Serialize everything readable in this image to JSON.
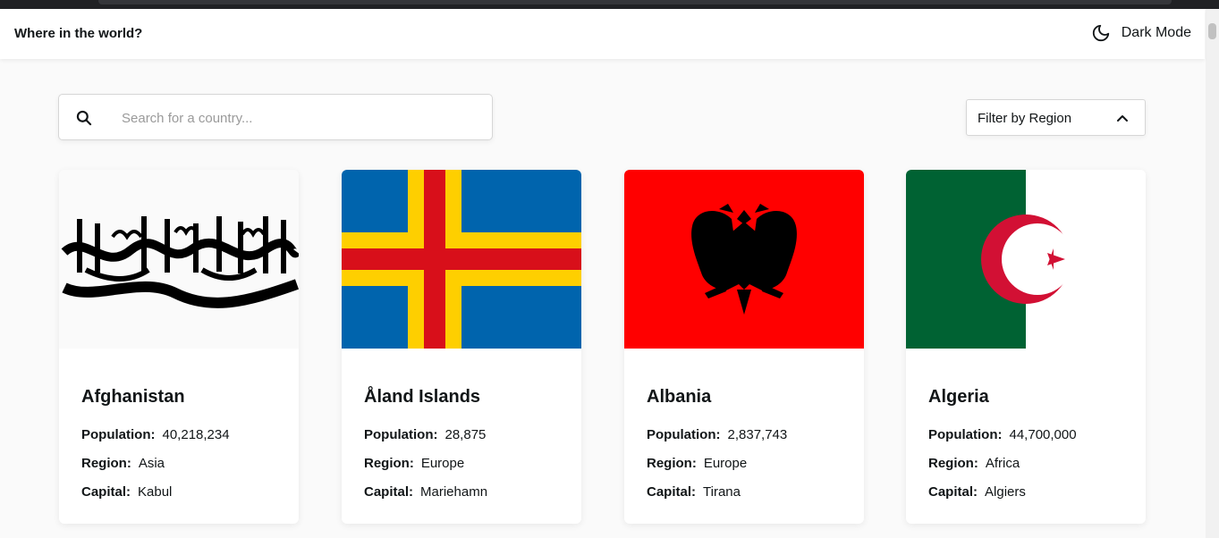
{
  "header": {
    "title": "Where in the world?",
    "mode_label": "Dark Mode",
    "mode_icon": "moon-icon"
  },
  "search": {
    "placeholder": "Search for a country...",
    "value": "",
    "icon": "search-icon"
  },
  "filter": {
    "label": "Filter by Region",
    "icon": "chevron-up-icon"
  },
  "labels": {
    "population": "Population:",
    "region": "Region:",
    "capital": "Capital:"
  },
  "countries": [
    {
      "name": "Afghanistan",
      "population": "40,218,234",
      "region": "Asia",
      "capital": "Kabul",
      "flag": "afghanistan-flag"
    },
    {
      "name": "Åland Islands",
      "population": "28,875",
      "region": "Europe",
      "capital": "Mariehamn",
      "flag": "aland-islands-flag"
    },
    {
      "name": "Albania",
      "population": "2,837,743",
      "region": "Europe",
      "capital": "Tirana",
      "flag": "albania-flag"
    },
    {
      "name": "Algeria",
      "population": "44,700,000",
      "region": "Africa",
      "capital": "Algiers",
      "flag": "algeria-flag"
    }
  ],
  "colors": {
    "background": "#fafafa",
    "element": "#ffffff",
    "text": "#111517"
  }
}
